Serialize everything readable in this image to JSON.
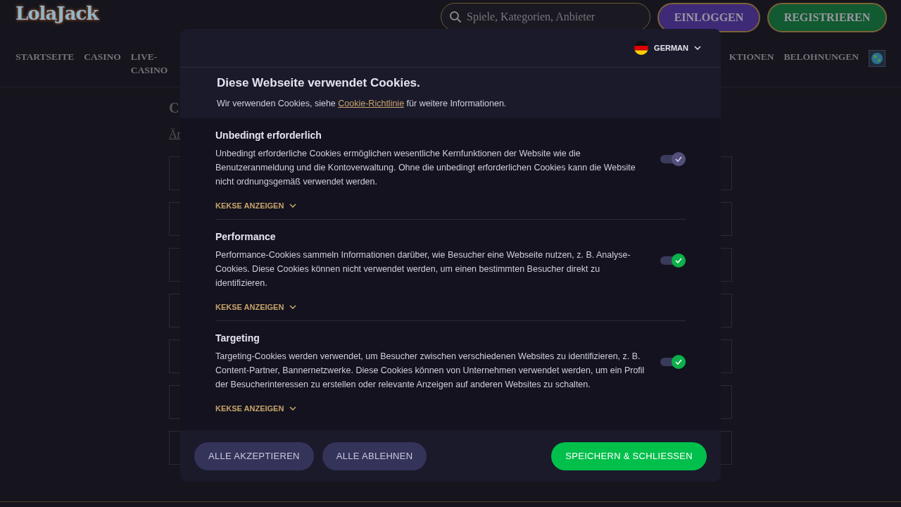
{
  "header": {
    "logo": "LolaJack",
    "search": {
      "placeholder": "Spiele, Kategorien, Anbieter"
    },
    "buttons": [
      {
        "label": "EINLOGGEN",
        "kind": "login"
      },
      {
        "label": "REGISTRIEREN",
        "kind": "register"
      }
    ]
  },
  "nav": {
    "items": [
      "STARTSEITE",
      "CASINO",
      "LIVE-CASINO"
    ],
    "right_items": [
      "KTIONEN",
      "BELOHNUNGEN"
    ]
  },
  "page": {
    "heading": "C",
    "link": "Är"
  },
  "cookie_dialog": {
    "language": {
      "label": "GERMAN"
    },
    "title": "Diese Webseite verwendet Cookies.",
    "intro": {
      "before": "Wir verwenden Cookies, siehe ",
      "link": "Cookie-Richtlinie",
      "after": " für weitere Informationen."
    },
    "categories": [
      {
        "title": "Unbedingt erforderlich",
        "description": "Unbedingt erforderliche Cookies ermöglichen wesentliche Kernfunktionen der Website wie die Benutzeranmeldung und die Kontoverwaltung. Ohne die unbedingt erforderlichen Cookies kann die Website nicht ordnungsgemäß verwendet werden.",
        "checked": true,
        "disabled": true,
        "toggle_label": "KEKSE ANZEIGEN",
        "expanded": false
      },
      {
        "title": "Performance",
        "description": "Performance-Cookies sammeln Informationen darüber, wie Besucher eine Webseite nutzen, z. B. Analyse-Cookies. Diese Cookies können nicht verwendet werden, um einen bestimmten Besucher direkt zu identifizieren.",
        "checked": true,
        "disabled": false,
        "toggle_label": "KEKSE ANZEIGEN",
        "expanded": false
      },
      {
        "title": "Targeting",
        "description": "Targeting-Cookies werden verwendet, um Besucher zwischen verschiedenen Websites zu identifizieren, z. B. Content-Partner, Bannernetzwerke. Diese Cookies können von Unternehmen verwendet werden, um ein Profil der Besucherinteressen zu erstellen oder relevante Anzeigen auf anderen Websites zu schalten.",
        "checked": true,
        "disabled": false,
        "toggle_label": "KEKSE ANZEIGEN",
        "expanded": false
      }
    ],
    "buttons": [
      {
        "label": "ALLE AKZEPTIEREN",
        "kind": "secondary"
      },
      {
        "label": "ALLE ABLEHNEN",
        "kind": "secondary"
      },
      {
        "label": "SPEICHERN & SCHLIESSEN",
        "kind": "primary"
      }
    ]
  }
}
